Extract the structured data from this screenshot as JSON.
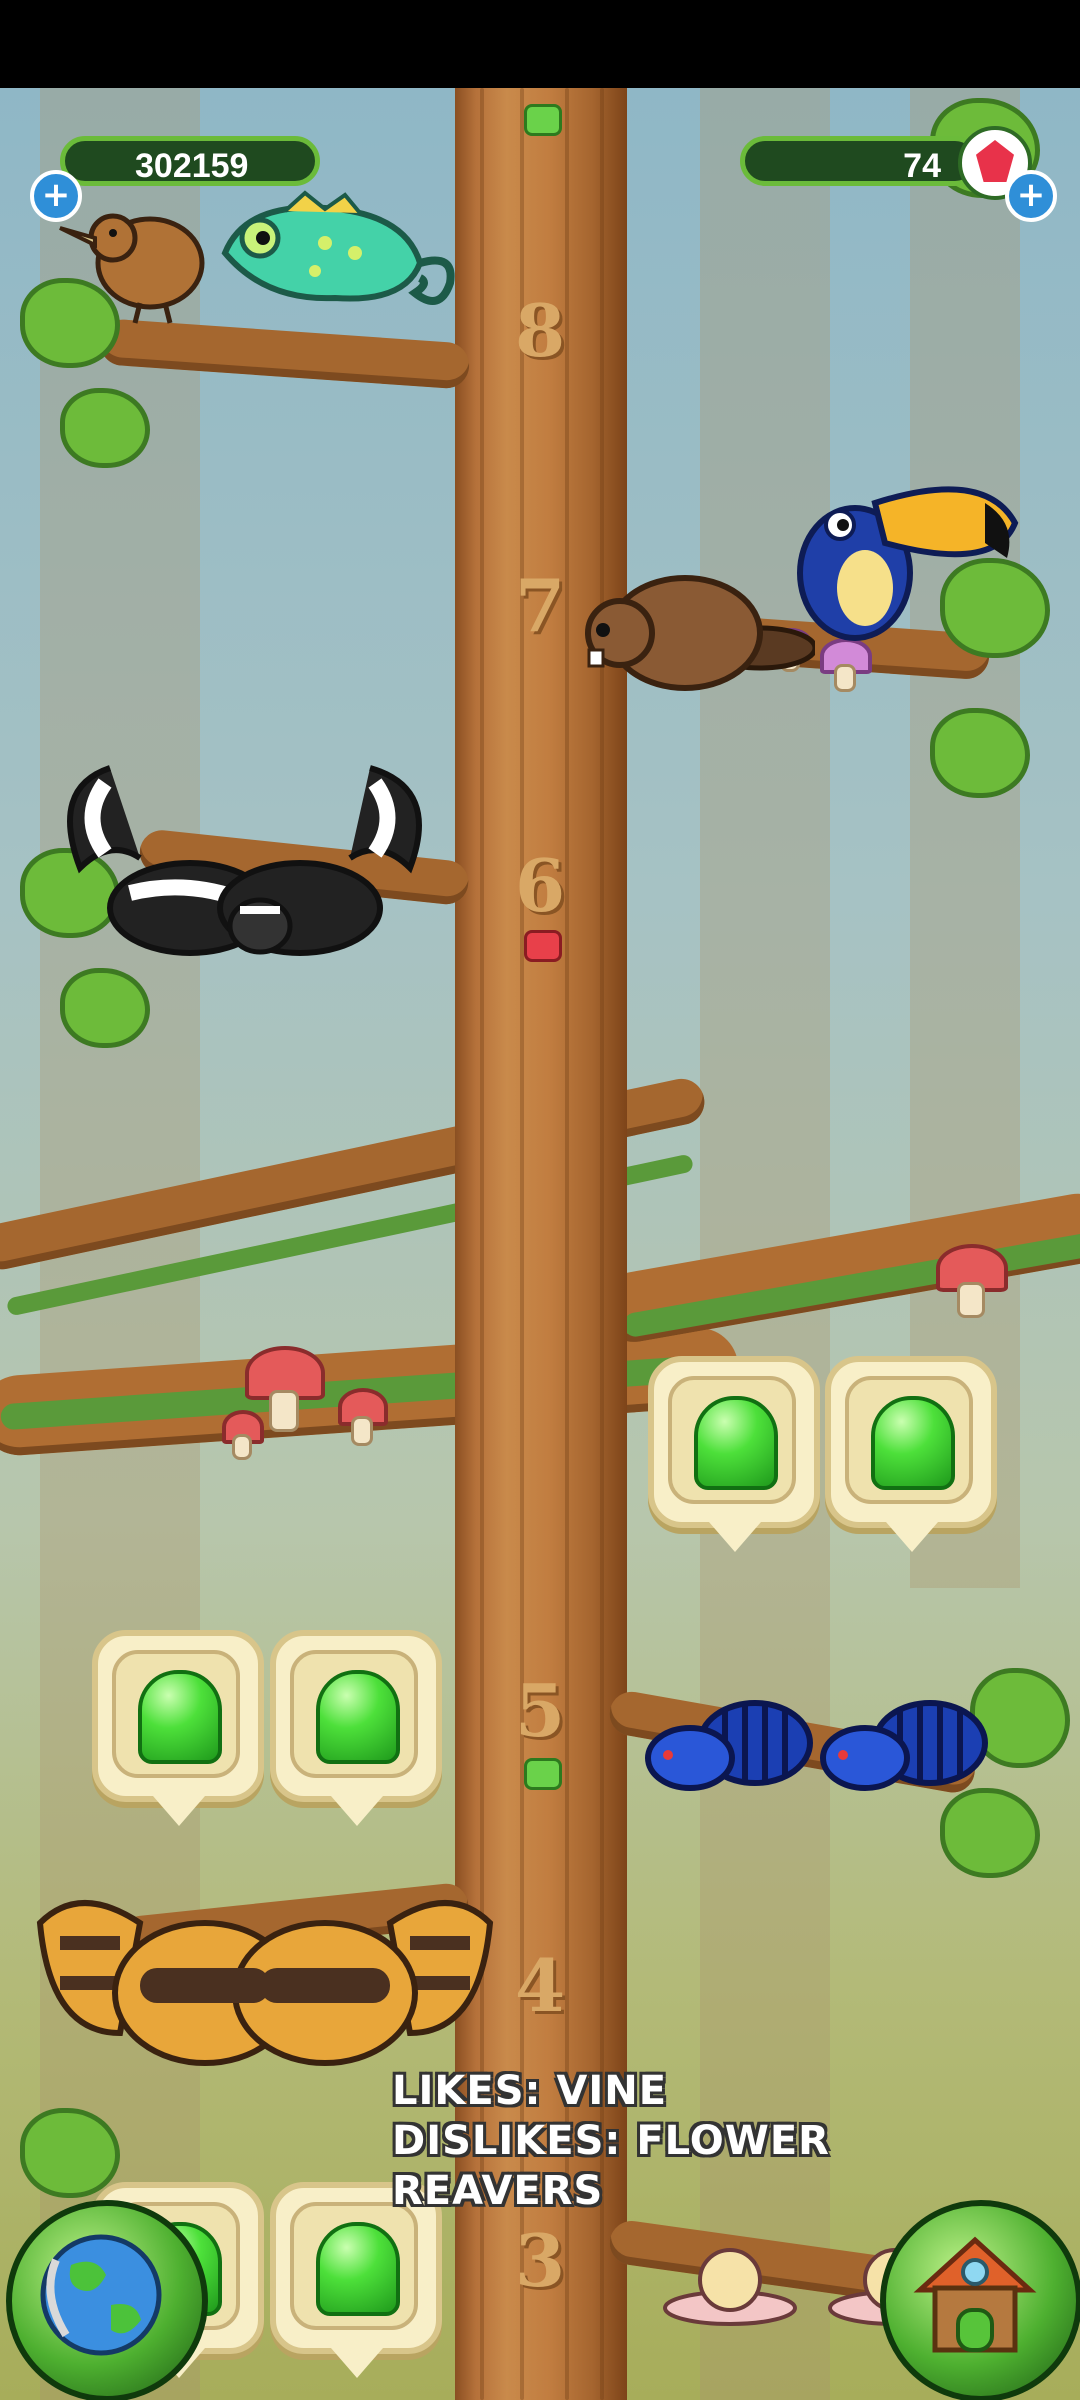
{
  "hud": {
    "gel_count": "302159",
    "gem_count": "74",
    "add_gel_label": "+",
    "add_gem_label": "+"
  },
  "floors": [
    "8",
    "7",
    "6",
    "5",
    "4",
    "3"
  ],
  "info": {
    "likes": "LIKES: VINE",
    "dislikes": "DISLIKES: FLOWER",
    "dislikes_cont": "REAVERS"
  },
  "gel_bubbles": 6,
  "colors": {
    "trunk": "#c17d40",
    "gel_green": "#3ad12c",
    "hud_bg": "#1f4a1f",
    "hud_border": "#6bbb3a",
    "plus_blue": "#2f8fd8",
    "gem_red": "#e8324a"
  },
  "icons": {
    "gel": "green-gel-drop",
    "gem": "red-gem",
    "map": "globe",
    "home": "treehouse"
  }
}
